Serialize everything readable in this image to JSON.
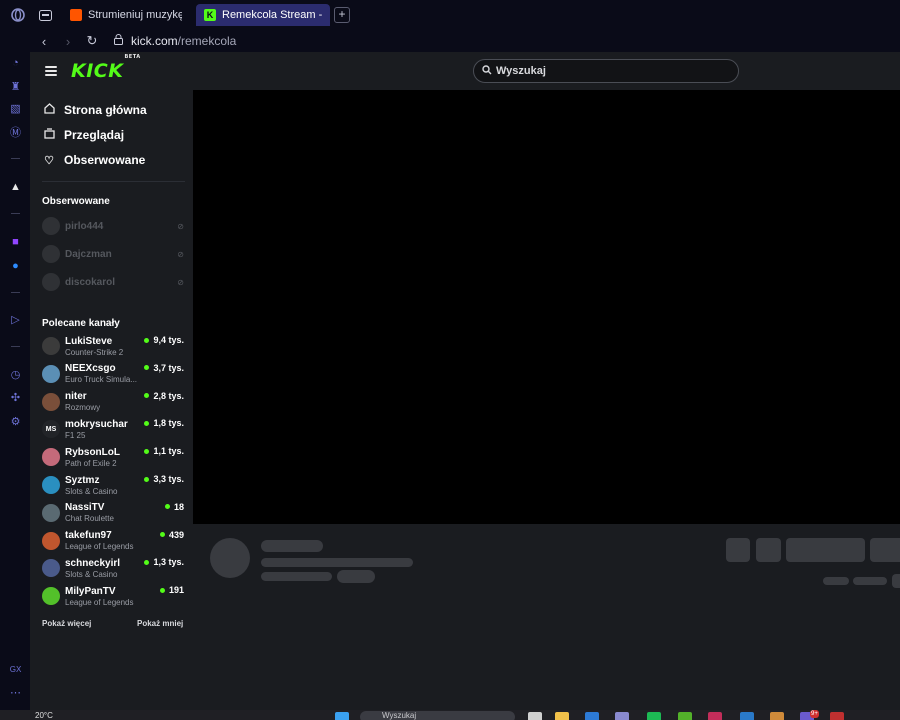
{
  "browser": {
    "tabs": [
      {
        "label": "Strumieniuj muzykę artyst",
        "favicon_color": "#ff5500",
        "active": false
      },
      {
        "label": "Remekcola Stream - Watc",
        "favicon_color": "#53fc18",
        "active": true
      }
    ],
    "new_tab_label": "+",
    "address": {
      "domain": "kick.com",
      "path": "/remekcola"
    }
  },
  "header": {
    "logo": "KICK",
    "logo_badge": "BETA",
    "search_placeholder": "Wyszukaj"
  },
  "nav": {
    "items": [
      {
        "label": "Strona główna",
        "icon": "home-icon"
      },
      {
        "label": "Przeglądaj",
        "icon": "browse-icon"
      },
      {
        "label": "Obserwowane",
        "icon": "heart-icon"
      }
    ]
  },
  "followed": {
    "title": "Obserwowane",
    "channels": [
      {
        "name": "pirlo444"
      },
      {
        "name": "Dajczman"
      },
      {
        "name": "discokarol"
      }
    ]
  },
  "recommended": {
    "title": "Polecane kanały",
    "channels": [
      {
        "name": "LukiSteve",
        "category": "Counter-Strike 2",
        "viewers": "9,4 tys.",
        "avatar_color": "#3b3b3b"
      },
      {
        "name": "NEEXcsgo",
        "category": "Euro Truck Simula...",
        "viewers": "3,7 tys.",
        "avatar_color": "#5b8fb5"
      },
      {
        "name": "niter",
        "category": "Rozmowy",
        "viewers": "2,8 tys.",
        "avatar_color": "#7a4f3a"
      },
      {
        "name": "mokrysuchar",
        "category": "F1 25",
        "viewers": "1,8 tys.",
        "avatar_color": "#222428",
        "avatar_text": "MS"
      },
      {
        "name": "RybsonLoL",
        "category": "Path of Exile 2",
        "viewers": "1,1 tys.",
        "avatar_color": "#c46a7a"
      },
      {
        "name": "Syztmz",
        "category": "Slots & Casino",
        "viewers": "3,3 tys.",
        "avatar_color": "#2a8fc0"
      },
      {
        "name": "NassiTV",
        "category": "Chat Roulette",
        "viewers": "18",
        "avatar_color": "#5a6a72"
      },
      {
        "name": "takefun97",
        "category": "League of Legends",
        "viewers": "439",
        "avatar_color": "#c0562e"
      },
      {
        "name": "schneckyirl",
        "category": "Slots & Casino",
        "viewers": "1,3 tys.",
        "avatar_color": "#4a5a8a"
      },
      {
        "name": "MilyPanTV",
        "category": "League of Legends",
        "viewers": "191",
        "avatar_color": "#53c02a"
      }
    ],
    "show_more": "Pokaż więcej",
    "show_less": "Pokaż mniej"
  },
  "taskbar": {
    "temperature": "20°C",
    "search_text": "Wyszukaj",
    "badge": "9+"
  },
  "colors": {
    "kick_green": "#53fc18",
    "panel_bg": "#1a1c20",
    "browser_bg": "#0a0b18",
    "active_tab": "#2b2c6e"
  }
}
